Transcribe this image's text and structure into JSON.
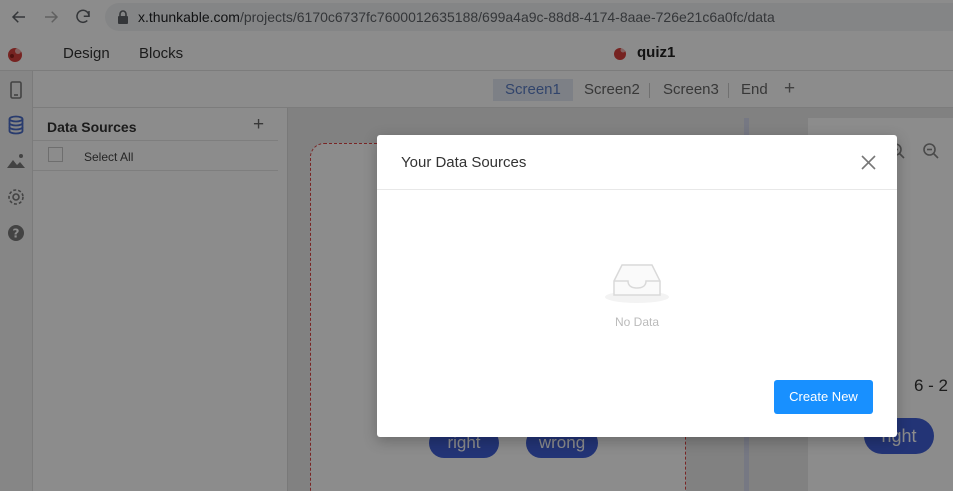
{
  "browser": {
    "url_host": "x.thunkable.com",
    "url_path": "/projects/6170c6737fc7600012635188/699a4a9c-88d8-4174-8aae-726e21c6a0fc/data"
  },
  "app": {
    "tabs": [
      {
        "label": "Design"
      },
      {
        "label": "Blocks"
      }
    ],
    "project_title": "quiz1"
  },
  "screens": {
    "tabs": [
      {
        "label": "Screen1"
      },
      {
        "label": "Screen2"
      },
      {
        "label": "Screen3"
      },
      {
        "label": "End"
      }
    ],
    "active": "Screen1",
    "add_label": "+"
  },
  "data_panel": {
    "title": "Data Sources",
    "add_label": "+",
    "select_all_label": "Select All"
  },
  "canvas": {
    "pill_right": "right",
    "pill_wrong": "wrong",
    "fraction_text": "6 - 2",
    "right_pill": "right"
  },
  "modal": {
    "title": "Your Data Sources",
    "empty_text": "No Data",
    "create_button": "Create New"
  },
  "colors": {
    "primary_button": "#1890ff",
    "active_tab_bg": "#e4eaf5",
    "pill_blue": "#4060d8"
  }
}
